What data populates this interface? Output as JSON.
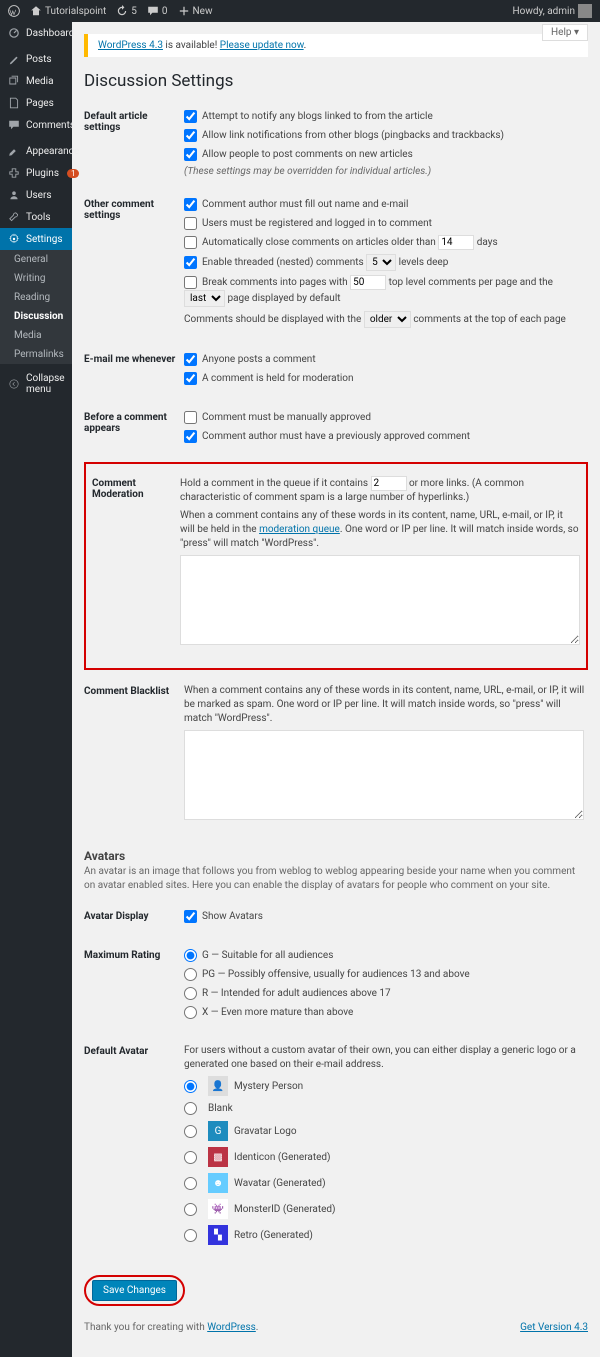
{
  "adminbar": {
    "site_name": "Tutorialspoint",
    "comments_count": "5",
    "updates_count": "0",
    "new_label": "New",
    "howdy": "Howdy, admin"
  },
  "menu": {
    "dashboard": "Dashboard",
    "posts": "Posts",
    "media": "Media",
    "pages": "Pages",
    "comments": "Comments",
    "appearance": "Appearance",
    "plugins": "Plugins",
    "plugins_badge": "1",
    "users": "Users",
    "tools": "Tools",
    "settings": "Settings",
    "collapse": "Collapse menu"
  },
  "submenu": {
    "general": "General",
    "writing": "Writing",
    "reading": "Reading",
    "discussion": "Discussion",
    "media": "Media",
    "permalinks": "Permalinks"
  },
  "help_label": "Help ▾",
  "update_nag": {
    "a1": "WordPress 4.3",
    "mid": " is available! ",
    "a2": "Please update now",
    "tail": "."
  },
  "page_title": "Discussion Settings",
  "rows": {
    "default_article": "Default article settings",
    "other_comment": "Other comment settings",
    "email_me": "E-mail me whenever",
    "before_appears": "Before a comment appears",
    "moderation": "Comment Moderation",
    "blacklist": "Comment Blacklist",
    "avatar_display": "Avatar Display",
    "max_rating": "Maximum Rating",
    "default_avatar": "Default Avatar"
  },
  "opts": {
    "pingback": "Attempt to notify any blogs linked to from the article",
    "trackback": "Allow link notifications from other blogs (pingbacks and trackbacks)",
    "allow_comments": "Allow people to post comments on new articles",
    "override_note": "(These settings may be overridden for individual articles.)",
    "name_email": "Comment author must fill out name and e-mail",
    "registered": "Users must be registered and logged in to comment",
    "autoclose_pre": "Automatically close comments on articles older than ",
    "autoclose_days": "14",
    "autoclose_post": " days",
    "threaded_pre": "Enable threaded (nested) comments ",
    "threaded_val": "5",
    "threaded_post": " levels deep",
    "paged_pre": "Break comments into pages with ",
    "paged_val": "50",
    "paged_mid": " top level comments per page and the ",
    "paged_sel": "last",
    "paged_post": " page displayed by default",
    "order_pre": "Comments should be displayed with the ",
    "order_sel": "older",
    "order_post": " comments at the top of each page",
    "email_anyone": "Anyone posts a comment",
    "email_held": "A comment is held for moderation",
    "manual_approve": "Comment must be manually approved",
    "prev_approved": "Comment author must have a previously approved comment",
    "mod_hold_pre": "Hold a comment in the queue if it contains ",
    "mod_hold_val": "2",
    "mod_hold_post": " or more links. (A common characteristic of comment spam is a large number of hyperlinks.)",
    "mod_hint_pre": "When a comment contains any of these words in its content, name, URL, e-mail, or IP, it will be held in the ",
    "mod_hint_link": "moderation queue",
    "mod_hint_post": ". One word or IP per line. It will match inside words, so \"press\" will match \"WordPress\".",
    "blacklist_hint": "When a comment contains any of these words in its content, name, URL, e-mail, or IP, it will be marked as spam. One word or IP per line. It will match inside words, so \"press\" will match \"WordPress\".",
    "avatars_heading": "Avatars",
    "avatars_desc": "An avatar is an image that follows you from weblog to weblog appearing beside your name when you comment on avatar enabled sites. Here you can enable the display of avatars for people who comment on your site.",
    "show_avatars": "Show Avatars",
    "rating_g": "G — Suitable for all audiences",
    "rating_pg": "PG — Possibly offensive, usually for audiences 13 and above",
    "rating_r": "R — Intended for adult audiences above 17",
    "rating_x": "X — Even more mature than above",
    "default_avatar_hint": "For users without a custom avatar of their own, you can either display a generic logo or a generated one based on their e-mail address.",
    "av_mystery": "Mystery Person",
    "av_blank": "Blank",
    "av_gravatar": "Gravatar Logo",
    "av_identicon": "Identicon (Generated)",
    "av_wavatar": "Wavatar (Generated)",
    "av_monsterid": "MonsterID (Generated)",
    "av_retro": "Retro (Generated)"
  },
  "save_label": "Save Changes",
  "footer": {
    "thanks_pre": "Thank you for creating with ",
    "wp": "WordPress",
    "version": "Get Version 4.3"
  }
}
